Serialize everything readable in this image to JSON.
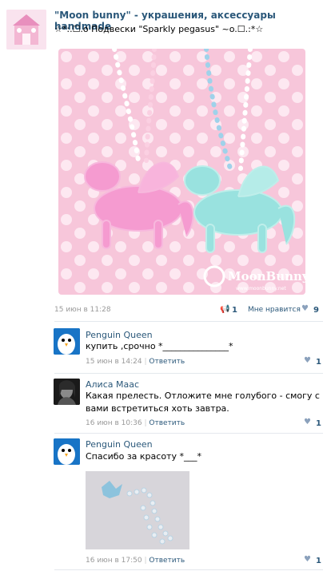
{
  "post": {
    "group_name": "\"Moon bunny\" - украшения, аксессуары handmade",
    "subtitle": "☆*:.☐.o Подвески \"Sparkly pegasus\" ~o.☐.:*☆",
    "watermark_brand": "MoonBunny",
    "watermark_url": "www.moonbunny.net",
    "timestamp": "15 июн в 11:28",
    "reposts": "1",
    "like_label": "Мне нравится",
    "likes": "9"
  },
  "comments": [
    {
      "author": "Penguin Queen",
      "text": "купить ,срочно *_______________*",
      "time": "15 июн в 14:24",
      "reply": "Ответить",
      "separator": "|",
      "likes": "1"
    },
    {
      "author": "Алиса Маас",
      "text": "Какая прелесть. Отложите мне голубого - смогу с вами встретиться хоть завтра.",
      "time": "16 июн в 10:36",
      "reply": "Ответить",
      "separator": "|",
      "likes": "1"
    },
    {
      "author": "Penguin Queen",
      "text": "Спасибо за красоту *___*",
      "time": "16 июн в 17:50",
      "reply": "Ответить",
      "separator": "|",
      "likes": "1"
    }
  ]
}
